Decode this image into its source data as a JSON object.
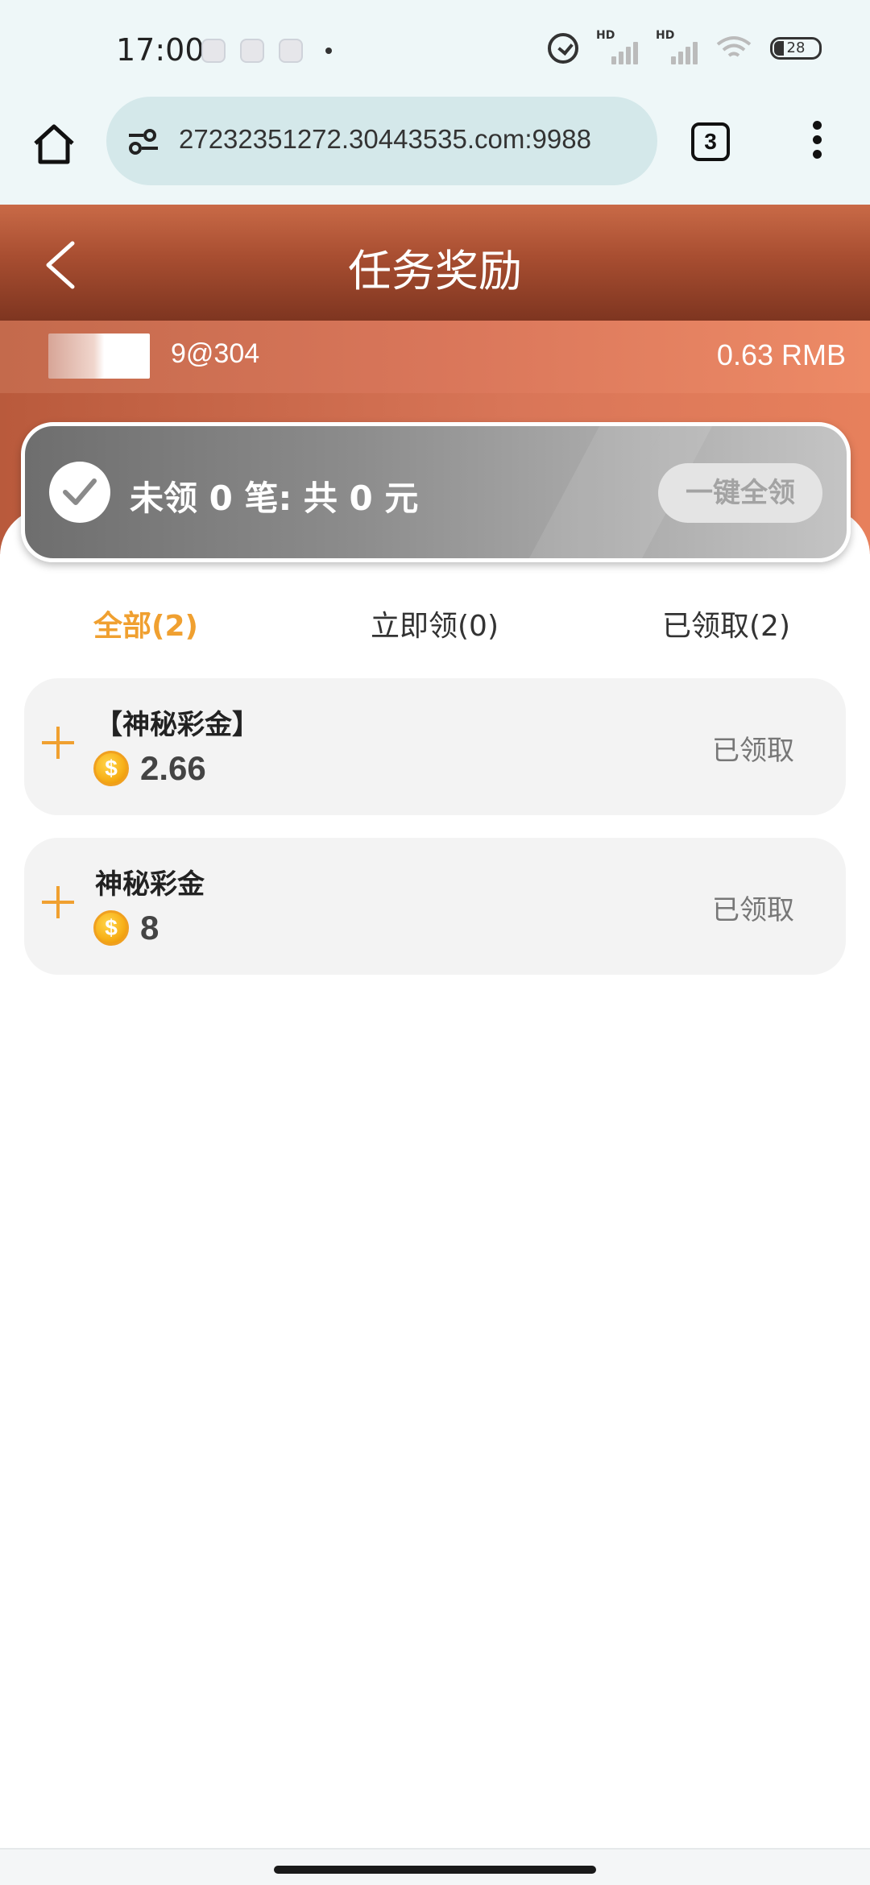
{
  "status_bar": {
    "time": "17:00",
    "signal1_label": "HD",
    "signal2_label": "HD",
    "battery": "28"
  },
  "browser": {
    "url": "27232351272.30443535.com:9988",
    "tab_count": "3"
  },
  "header": {
    "title": "任务奖励"
  },
  "account": {
    "id": "9@304",
    "balance": "0.63 RMB"
  },
  "claim_card": {
    "summary": "未领 0 笔: 共 0 元",
    "claim_all_label": "一键全领"
  },
  "tabs": [
    {
      "label": "全部(2)",
      "active": true
    },
    {
      "label": "立即领(0)",
      "active": false
    },
    {
      "label": "已领取(2)",
      "active": false
    }
  ],
  "rewards": [
    {
      "title": "【神秘彩金】",
      "amount": "2.66",
      "status": "已领取"
    },
    {
      "title": "神秘彩金",
      "amount": "8",
      "status": "已领取"
    }
  ],
  "colors": {
    "accent": "#f0a030",
    "header_top": "#c96a47",
    "header_bottom": "#7e3520"
  },
  "icons": {
    "coin_symbol": "$"
  }
}
